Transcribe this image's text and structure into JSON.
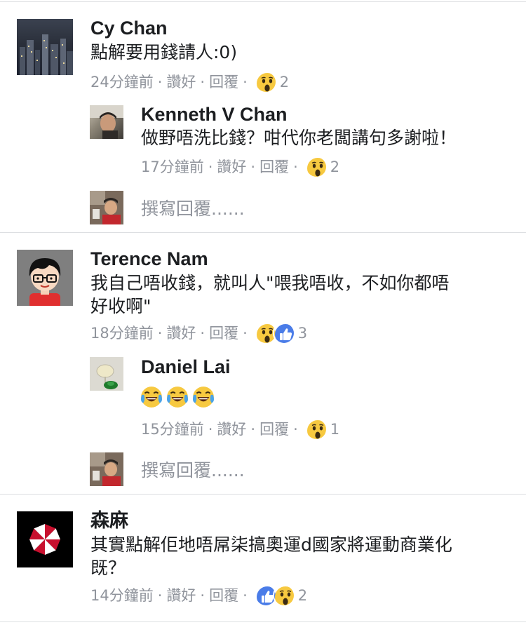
{
  "comments": [
    {
      "author": "Cy Chan",
      "text": "點解要用錢請人:0)",
      "time": "24分鐘前",
      "like": "讚好",
      "reply": "回覆",
      "reaction_count": "2",
      "reactions": [
        "wow-icon"
      ],
      "replies": [
        {
          "author": "Kenneth V Chan",
          "text": "做野唔洗比錢？咁代你老闆講句多謝啦！",
          "time": "17分鐘前",
          "like": "讚好",
          "reply": "回覆",
          "reaction_count": "2",
          "reactions": [
            "wow-icon"
          ]
        }
      ],
      "reply_placeholder": "撰寫回覆......"
    },
    {
      "author": "Terence Nam",
      "text_line1": "我自己唔收錢，就叫人\"喂我唔收，不如你都唔",
      "text_line2": "好收啊\"",
      "time": "18分鐘前",
      "like": "讚好",
      "reply": "回覆",
      "reaction_count": "3",
      "reactions": [
        "wow-icon",
        "like-icon"
      ],
      "replies": [
        {
          "author": "Daniel Lai",
          "emojis": [
            "tears-of-joy-emoji",
            "tears-of-joy-emoji",
            "tears-of-joy-emoji"
          ],
          "time": "15分鐘前",
          "like": "讚好",
          "reply": "回覆",
          "reaction_count": "1",
          "reactions": [
            "wow-icon"
          ]
        }
      ],
      "reply_placeholder": "撰寫回覆......"
    },
    {
      "author": "森麻",
      "text_line1": "其實點解佢地唔屌柒搞奧運d國家將運動商業化",
      "text_line2": "既？",
      "time": "14分鐘前",
      "like": "讚好",
      "reply": "回覆",
      "reaction_count": "2",
      "reactions": [
        "like-icon",
        "wow-icon"
      ]
    }
  ],
  "colors": {
    "like_blue": "#4a7ce8",
    "wow_yellow": "#f7c940",
    "meta_grey": "#90949c",
    "separator": "#dddfe2"
  }
}
